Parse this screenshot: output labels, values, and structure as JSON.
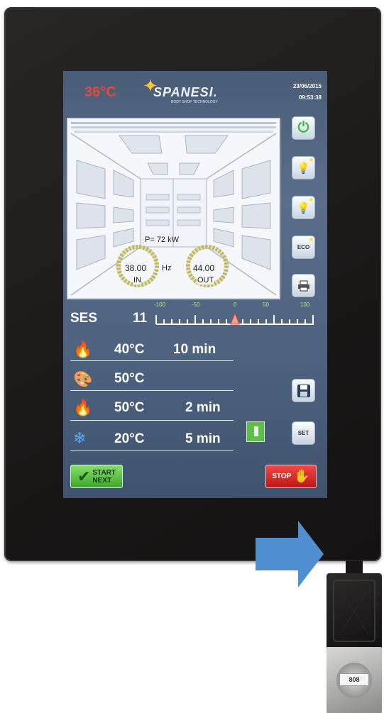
{
  "header": {
    "temperature": "36°C",
    "brand": "SPANESI.",
    "brand_subtitle": "BODY SHOP TECHNOLOGY",
    "date": "23/06/2015",
    "time": "09:53:38"
  },
  "booth": {
    "power": "P=  72 kW",
    "in_value": "38.00",
    "in_label": "IN",
    "hz_label": "Hz",
    "out_value": "44.00",
    "out_label": "OUT"
  },
  "side_buttons": [
    {
      "icon": "power-icon",
      "label": ""
    },
    {
      "icon": "lightbulb-icon",
      "label": ""
    },
    {
      "icon": "lightbulb-icon",
      "label": ""
    },
    {
      "icon": "eco-icon",
      "label": "ECO"
    },
    {
      "icon": "printer-icon",
      "label": ""
    }
  ],
  "ses": {
    "label": "SES",
    "value": "11",
    "scale": [
      "-100",
      "-50",
      "0",
      "50",
      "100"
    ]
  },
  "phases": [
    {
      "icon": "flame-icon",
      "temp": "40°C",
      "time": "10 min"
    },
    {
      "icon": "palette-icon",
      "temp": "50°C",
      "time": ""
    },
    {
      "icon": "double-flame-icon",
      "temp": "50°C",
      "time": "2 min"
    },
    {
      "icon": "snowflake-icon",
      "temp": "20°C",
      "time": "5 min"
    }
  ],
  "buttons": {
    "save_label": "",
    "set_label": "SET",
    "start_label_1": "START",
    "start_label_2": "NEXT",
    "stop_label": "STOP"
  },
  "colors": {
    "accent_red": "#e8483c",
    "gauge_yellow": "#f0d530",
    "scale_green": "#a8f06a",
    "start_green": "#5ec04a",
    "stop_red": "#e2282a",
    "arrow_blue": "#4f8fd0"
  },
  "hardware": {
    "port_label": "808"
  }
}
